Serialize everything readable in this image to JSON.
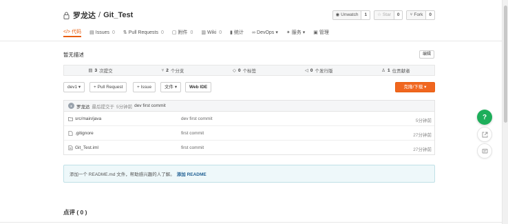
{
  "repo": {
    "owner": "罗龙达",
    "separator": "/",
    "name": "Git_Test"
  },
  "actions": {
    "unwatch": {
      "label": "Unwatch",
      "count": "1"
    },
    "star": {
      "label": "Star",
      "count": "0"
    },
    "fork": {
      "label": "Fork",
      "count": "0"
    }
  },
  "tabs": [
    {
      "label": "代码",
      "count": "",
      "icon": "code-icon"
    },
    {
      "label": "Issues",
      "count": "0",
      "icon": "issue-icon"
    },
    {
      "label": "Pull Requests",
      "count": "0",
      "icon": "pull-request-icon"
    },
    {
      "label": "附件",
      "count": "0",
      "icon": "attachment-icon"
    },
    {
      "label": "Wiki",
      "count": "0",
      "icon": "wiki-icon"
    },
    {
      "label": "统计",
      "count": "",
      "icon": "stats-icon"
    },
    {
      "label": "DevOps",
      "count": "",
      "icon": "devops-icon"
    },
    {
      "label": "服务",
      "count": "",
      "icon": "service-icon"
    },
    {
      "label": "管理",
      "count": "",
      "icon": "manage-icon"
    }
  ],
  "description": {
    "text": "暂无描述",
    "edit_label": "编辑"
  },
  "stats": {
    "commits": {
      "num": "3",
      "label": "次提交"
    },
    "branches": {
      "num": "2",
      "label": "个分支"
    },
    "tags": {
      "num": "0",
      "label": "个标签"
    },
    "releases": {
      "num": "0",
      "label": "个发行版"
    },
    "contributors": {
      "num": "1",
      "label": "位贡献者"
    }
  },
  "toolbar": {
    "branch": "dev1",
    "pull_request": "+ Pull Request",
    "issue": "+ Issue",
    "file": "文件",
    "web_ide": "Web IDE",
    "clone": "克隆/下载"
  },
  "last_commit": {
    "author": "罗龙达",
    "meta": "最后提交于",
    "time": "5分钟前",
    "message": "dev first commit"
  },
  "files": [
    {
      "name": "src/main/java",
      "type": "folder",
      "message": "dev first commit",
      "time": "5分钟前"
    },
    {
      "name": ".gitignore",
      "type": "file",
      "message": "first commit",
      "time": "27分钟前"
    },
    {
      "name": "Git_Test.iml",
      "type": "file",
      "message": "first commit",
      "time": "27分钟前"
    }
  ],
  "readme_hint": {
    "text": "添加一个 README.md 文件，帮助感兴趣的人了解。",
    "link": "添加 README"
  },
  "comments": {
    "label": "点评 ( 0 )"
  },
  "colors": {
    "accent": "#e85e0f",
    "help": "#1dae5a",
    "link": "#1f5f93"
  }
}
